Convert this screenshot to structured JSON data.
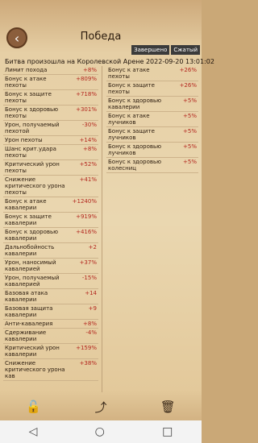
{
  "header": {
    "title": "Победа",
    "back_icon": "chevron-left-icon",
    "tags": [
      "Завершено",
      "Сжатый"
    ]
  },
  "battle_title": "Битва произошла на Королевской Арене",
  "battle_time": "2022-09-20 13:01:02",
  "left_rows": [
    {
      "name": "Лимит похода",
      "value": "+8%"
    },
    {
      "name": "Бонус к атаке пехоты",
      "value": "+809%"
    },
    {
      "name": "Бонус к защите пехоты",
      "value": "+718%"
    },
    {
      "name": "Бонус к здоровью пехоты",
      "value": "+301%"
    },
    {
      "name": "Урон, получаемый пехотой",
      "value": "-30%"
    },
    {
      "name": "Урон пехоты",
      "value": "+14%"
    },
    {
      "name": "Шанс крит.удара пехоты",
      "value": "+8%"
    },
    {
      "name": "Критический урон пехоты",
      "value": "+52%"
    },
    {
      "name": "Снижение критического урона пехоты",
      "value": "+41%"
    },
    {
      "name": "Бонус к атаке кавалерии",
      "value": "+1240%"
    },
    {
      "name": "Бонус к защите кавалерии",
      "value": "+919%"
    },
    {
      "name": "Бонус к здоровью кавалерии",
      "value": "+416%"
    },
    {
      "name": "Дальнобойность кавалерии",
      "value": "+2"
    },
    {
      "name": "Урон, наносимый кавалерией",
      "value": "+37%"
    },
    {
      "name": "Урон, получаемый кавалерией",
      "value": "-15%"
    },
    {
      "name": "Базовая атака кавалерии",
      "value": "+14"
    },
    {
      "name": "Базовая защита кавалерии",
      "value": "+9"
    },
    {
      "name": "Анти-кавалерия",
      "value": "+8%"
    },
    {
      "name": "Сдерживание кавалерии",
      "value": "-4%"
    },
    {
      "name": "Критический урон кавалерии",
      "value": "+159%"
    },
    {
      "name": "Снижение критического урона кав",
      "value": "+38%"
    }
  ],
  "right_rows": [
    {
      "name": "Бонус к атаке пехоты",
      "value": "+26%"
    },
    {
      "name": "Бонус к защите пехоты",
      "value": "+26%"
    },
    {
      "name": "Бонус к здоровью кавалерии",
      "value": "+5%"
    },
    {
      "name": "Бонус к атаке лучников",
      "value": "+5%"
    },
    {
      "name": "Бонус к защите лучников",
      "value": "+5%"
    },
    {
      "name": "Бонус к здоровью лучников",
      "value": "+5%"
    },
    {
      "name": "Бонус к здоровью колесниц",
      "value": "+5%"
    }
  ],
  "footer": {
    "icons": [
      "unlock-icon",
      "share-icon",
      "trash-icon"
    ]
  },
  "navbar": {
    "icons": [
      "back-triangle-icon",
      "home-circle-icon",
      "recent-square-icon"
    ]
  }
}
